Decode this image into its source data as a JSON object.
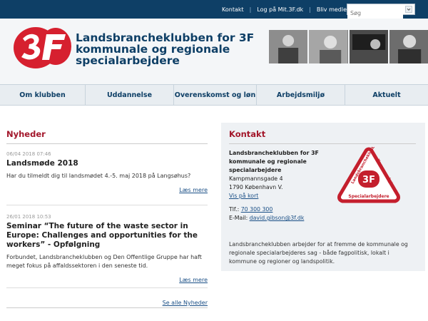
{
  "topbar": {
    "links": [
      "Kontakt",
      "Log på Mit.3F.dk",
      "Bliv medlem"
    ],
    "search_placeholder": "Søg"
  },
  "header": {
    "title": "Landsbrancheklubben for 3F kommunale og regionale specialarbejdere"
  },
  "nav": {
    "items": [
      "Om klubben",
      "Uddannelse",
      "Overenskomst og løn",
      "Arbejdsmiljø",
      "Aktuelt"
    ]
  },
  "news": {
    "heading": "Nyheder",
    "items": [
      {
        "date": "06/04 2018 07:46",
        "title": "Landsmøde 2018",
        "body": "Har du tilmeldt dig til landsmødet 4.-5. maj 2018 på Langsøhus?",
        "more": "Læs mere"
      },
      {
        "date": "26/01 2018 10:53",
        "title": "Seminar “The future of the waste sector in Europe: Challenges and opportunities for the workers” - Opfølgning",
        "body": "Forbundet, Landsbrancheklubben og Den Offentlige Gruppe har haft meget fokus på affaldssektoren i den seneste tid.",
        "more": "Læs mere"
      }
    ],
    "all_link": "Se alle Nyheder"
  },
  "contact": {
    "heading": "Kontakt",
    "org": "Landsbrancheklubben for 3F kommunale og regionale specialarbejdere",
    "street": "Kampmannsgade 4",
    "city": "1790 København V.",
    "map_link": "Vis på kort",
    "phone_label": "Tlf.: ",
    "phone": "70 300 300",
    "email_label": "E-Mail: ",
    "email": "david.gibson@3f.dk",
    "badge_text": [
      "Landsbrancheklubben for",
      "Kommunale og",
      "regionale",
      "Specialarbejdere",
      "3F"
    ],
    "description": "Landsbrancheklubben arbejder for at fremme de kommunale og regionale specialarbejderes sag - både fagpolitisk, lokalt i kommune og regioner og landspolitik."
  },
  "colors": {
    "brand_navy": "#0e3f66",
    "accent_red": "#a3172b",
    "link": "#1a4f86"
  }
}
